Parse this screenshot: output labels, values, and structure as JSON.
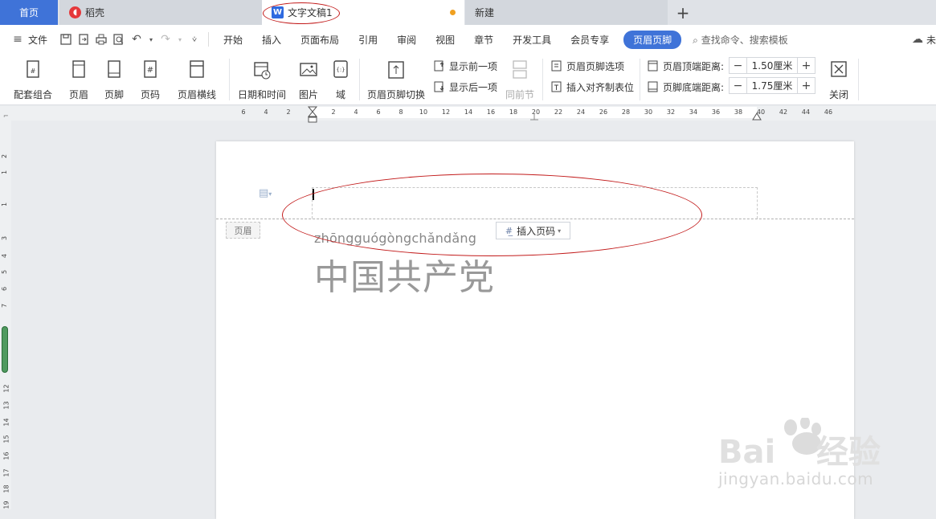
{
  "tabs": {
    "home": "首页",
    "daoke": "稻壳",
    "document": "文字文稿1",
    "new_tab": "新建",
    "add": "+"
  },
  "menu": {
    "file": "文件",
    "items": [
      "开始",
      "插入",
      "页面布局",
      "引用",
      "审阅",
      "视图",
      "章节",
      "开发工具",
      "会员专享"
    ],
    "active": "页眉页脚",
    "search": "查找命令、搜索模板",
    "cloud": "未"
  },
  "ribbon": {
    "combo": "配套组合",
    "header": "页眉",
    "footer": "页脚",
    "page_no": "页码",
    "header_line": "页眉横线",
    "datetime": "日期和时间",
    "picture": "图片",
    "field": "域",
    "switch": "页眉页脚切换",
    "show_prev": "显示前一项",
    "show_next": "显示后一项",
    "same_prev": "同前节",
    "hf_options": "页眉页脚选项",
    "insert_align": "插入对齐制表位",
    "top_dist_label": "页眉顶端距离:",
    "top_dist_value": "1.50厘米",
    "bottom_dist_label": "页脚底端距离:",
    "bottom_dist_value": "1.75厘米",
    "close": "关闭"
  },
  "ruler": {
    "h_ticks": [
      "6",
      "4",
      "2",
      "2",
      "4",
      "6",
      "8",
      "10",
      "12",
      "14",
      "16",
      "18",
      "20",
      "22",
      "24",
      "26",
      "28",
      "30",
      "32",
      "34",
      "36",
      "38",
      "40",
      "42",
      "44",
      "46"
    ],
    "v_ticks": [
      "2",
      "1",
      "1",
      "3",
      "4",
      "5",
      "6",
      "7",
      "12",
      "13",
      "14",
      "15",
      "16",
      "17",
      "18",
      "19"
    ]
  },
  "document": {
    "header_tag": "页眉",
    "insert_page_no": "插入页码",
    "pinyin": "zhōngguógòngchǎndǎng",
    "hanzi": "中国共产党"
  },
  "watermark": {
    "text": "jingyan.baidu.com"
  },
  "colors": {
    "accent": "#3f73d8",
    "annotation": "#c21a1a"
  }
}
